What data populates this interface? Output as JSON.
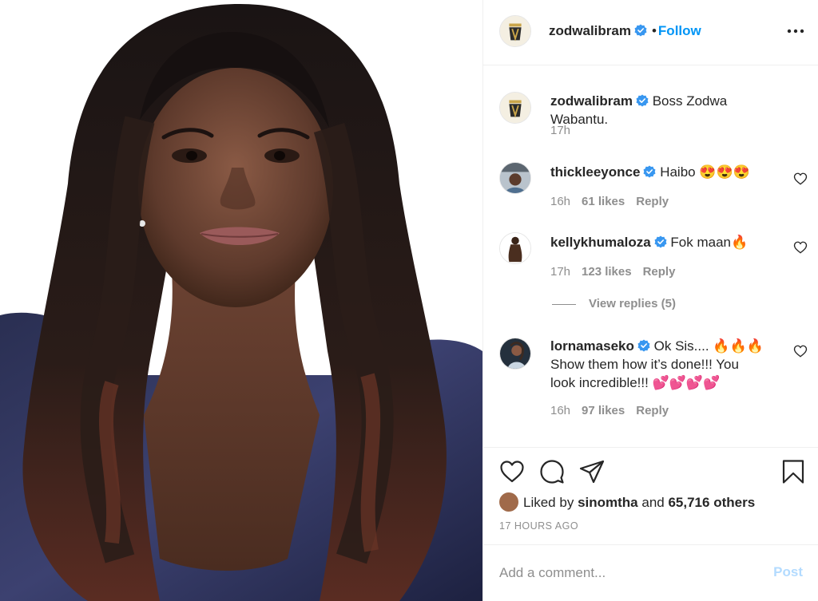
{
  "post": {
    "author": "zodwalibram",
    "follow_label": "Follow",
    "separator": "•",
    "more_icon": "more-horizontal-icon"
  },
  "caption": {
    "username": "zodwalibram",
    "text": "Boss Zodwa Wabantu.",
    "time": "17h"
  },
  "comments": [
    {
      "username": "thickleeyonce",
      "text": "Haibo 😍😍😍",
      "time": "16h",
      "likes": "61 likes",
      "reply": "Reply"
    },
    {
      "username": "kellykhumaloza",
      "text": "Fok maan🔥",
      "time": "17h",
      "likes": "123 likes",
      "reply": "Reply"
    },
    {
      "username": "lornamaseko",
      "text": "Ok Sis.... 🔥🔥🔥 Show them how it’s done!!! You look incredible!!! 💕💕💕💕",
      "time": "16h",
      "likes": "97 likes",
      "reply": "Reply"
    }
  ],
  "view_replies": "View replies (5)",
  "likes": {
    "prefix": "Liked by",
    "user": "sinomtha",
    "connector": "and",
    "others": "65,716 others"
  },
  "timestamp": "17 HOURS AGO",
  "add_comment": {
    "placeholder": "Add a comment...",
    "post_label": "Post"
  },
  "colors": {
    "link_blue": "#0095f6",
    "verified_blue": "#3897f0",
    "muted": "#8e8e8e",
    "post_disabled": "#b3dbff"
  }
}
